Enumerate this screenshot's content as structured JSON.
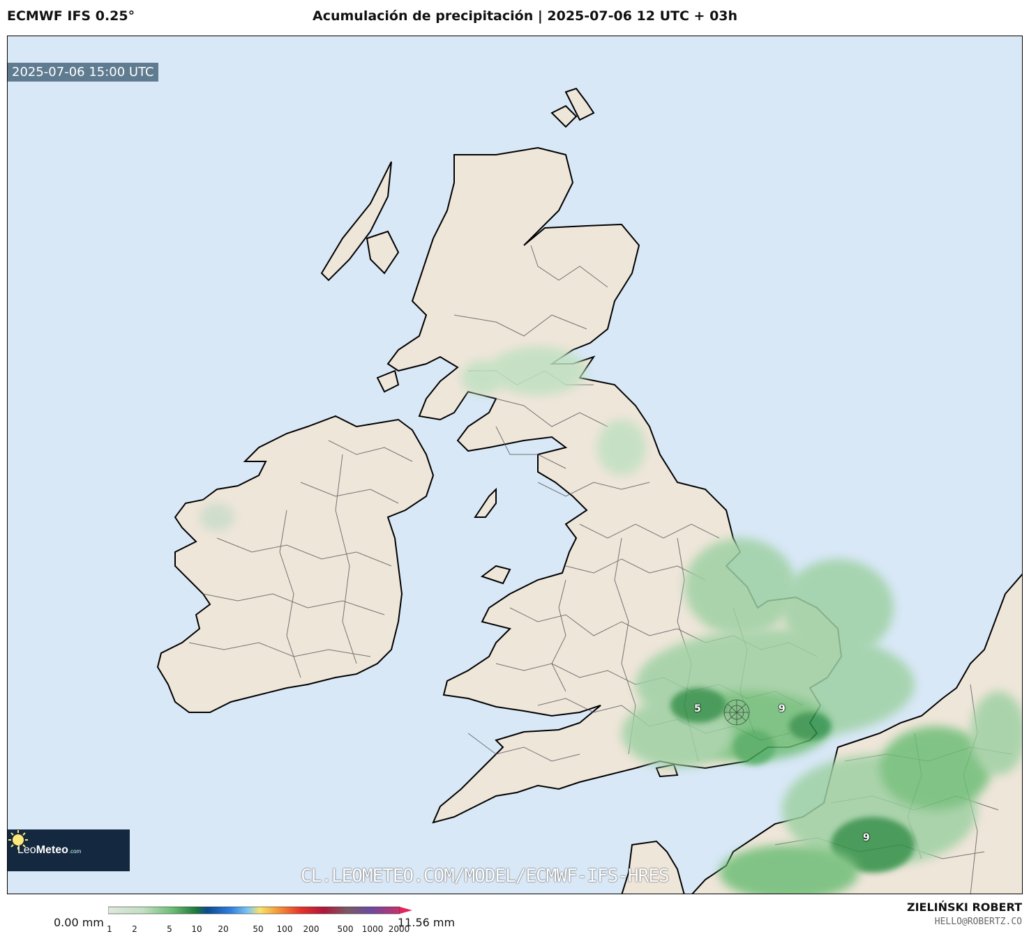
{
  "header": {
    "model_name": "ECMWF IFS 0.25°",
    "title": "Acumulación de precipitación | 2025-07-06 12 UTC + 03h"
  },
  "map": {
    "valid_time": "2025-07-06 15:00 UTC",
    "watermark_url": "CL.LEOMETEO.COM/MODEL/ECMWF-IFS-HRES",
    "logo": {
      "brand_light": "Leo",
      "brand_bold": "Meteo",
      "brand_domain": ".com"
    },
    "value_labels": [
      "5",
      "9",
      "9"
    ],
    "colors": {
      "sea": "#d9e8f7",
      "land": "#efe6da",
      "precip_light": "#bfe0c1",
      "precip_mid": "#6dbd76",
      "precip_dark": "#2f8f45"
    }
  },
  "colorbar": {
    "min_label": "0.00 mm",
    "max_label": "11.56 mm",
    "ticks": [
      "1",
      "2",
      "5",
      "10",
      "20",
      "50",
      "100",
      "200",
      "500",
      "1000",
      "2000"
    ]
  },
  "footer": {
    "author": "ZIELIŃSKI ROBERT",
    "email": "HELLO@ROBERTZ.CO"
  }
}
